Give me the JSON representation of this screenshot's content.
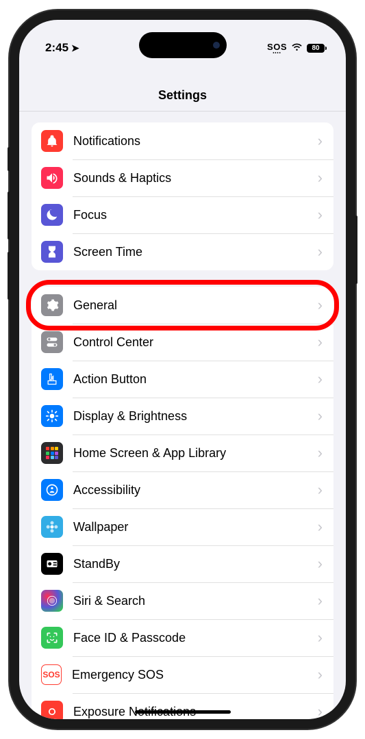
{
  "status": {
    "time": "2:45",
    "sos": "SOS",
    "battery": "80"
  },
  "header": {
    "title": "Settings"
  },
  "groups": [
    {
      "id": "alerts",
      "rows": [
        {
          "id": "notifications",
          "label": "Notifications",
          "icon": "bell-icon",
          "iconBg": "bg-red"
        },
        {
          "id": "sounds",
          "label": "Sounds & Haptics",
          "icon": "speaker-icon",
          "iconBg": "bg-pink"
        },
        {
          "id": "focus",
          "label": "Focus",
          "icon": "moon-icon",
          "iconBg": "bg-indigo"
        },
        {
          "id": "screentime",
          "label": "Screen Time",
          "icon": "hourglass-icon",
          "iconBg": "bg-indigo"
        }
      ]
    },
    {
      "id": "system",
      "rows": [
        {
          "id": "general",
          "label": "General",
          "icon": "gear-icon",
          "iconBg": "bg-gray",
          "highlighted": true
        },
        {
          "id": "controlcenter",
          "label": "Control Center",
          "icon": "switches-icon",
          "iconBg": "bg-gray"
        },
        {
          "id": "actionbutton",
          "label": "Action Button",
          "icon": "action-icon",
          "iconBg": "bg-blue"
        },
        {
          "id": "display",
          "label": "Display & Brightness",
          "icon": "sun-icon",
          "iconBg": "bg-blue"
        },
        {
          "id": "homescreen",
          "label": "Home Screen & App Library",
          "icon": "grid-icon",
          "iconBg": "bg-homegrid"
        },
        {
          "id": "accessibility",
          "label": "Accessibility",
          "icon": "person-icon",
          "iconBg": "bg-blue"
        },
        {
          "id": "wallpaper",
          "label": "Wallpaper",
          "icon": "flower-icon",
          "iconBg": "bg-lightblue"
        },
        {
          "id": "standby",
          "label": "StandBy",
          "icon": "clock-icon",
          "iconBg": "bg-black"
        },
        {
          "id": "siri",
          "label": "Siri & Search",
          "icon": "siri-icon",
          "iconBg": "bg-siri"
        },
        {
          "id": "faceid",
          "label": "Face ID & Passcode",
          "icon": "face-icon",
          "iconBg": "bg-green"
        },
        {
          "id": "emergencysos",
          "label": "Emergency SOS",
          "icon": "sos-text-icon",
          "iconBg": "sos"
        },
        {
          "id": "exposure",
          "label": "Exposure Notifications",
          "icon": "virus-icon",
          "iconBg": "bg-red"
        }
      ]
    }
  ],
  "highlightRow": "general"
}
